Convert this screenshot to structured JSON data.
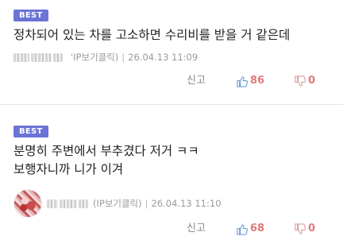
{
  "comments": [
    {
      "badge": "BEST",
      "lines": [
        "정차되어 있는 차를 고소하면 수리비를 받을 거 같은데"
      ],
      "ip_label": "'IP보기클릭)",
      "date": "26.04.13 11:09",
      "report_label": "신고",
      "likes": "86",
      "dislikes": "0"
    },
    {
      "badge": "BEST",
      "lines": [
        "분명히 주변에서 부추겼다 저거 ㅋㅋ",
        "보행자니까 니가 이겨"
      ],
      "ip_label": "(IP보기클릭)",
      "date": "26.04.13 11:10",
      "report_label": "신고",
      "likes": "68",
      "dislikes": "0"
    }
  ],
  "colors": {
    "badge_bg": "#6b73d6",
    "like_count": "#e07a7a",
    "meta_text": "#9a9a9a",
    "thumb_up_icon": "#6fa0d8",
    "thumb_down_icon": "#d9a0a0"
  }
}
